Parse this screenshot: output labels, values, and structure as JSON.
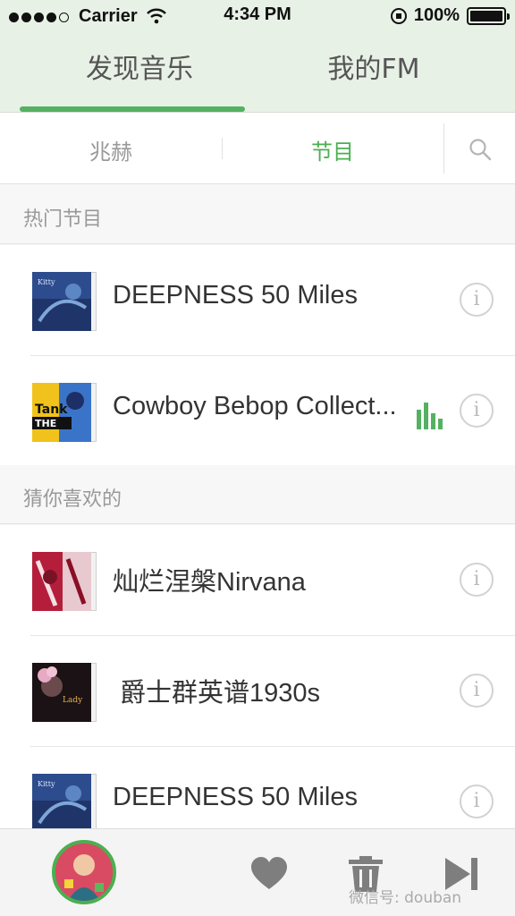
{
  "status_bar": {
    "carrier": "Carrier",
    "time": "4:34 PM",
    "battery": "100%"
  },
  "main_tabs": [
    {
      "label": "发现音乐",
      "active": true
    },
    {
      "label": "我的FM",
      "active": false
    }
  ],
  "segments": [
    {
      "label": "兆赫",
      "active": false
    },
    {
      "label": "节目",
      "active": true
    }
  ],
  "sections": [
    {
      "title": "热门节目",
      "items": [
        {
          "title": "DEEPNESS 50 Miles",
          "cover": "blue-album-art",
          "playing": false
        },
        {
          "title": "Cowboy Bebop Collect...",
          "cover": "cowboy-bebop-art",
          "playing": true
        }
      ]
    },
    {
      "title": "猜你喜欢的",
      "items": [
        {
          "title": "灿烂涅槃Nirvana",
          "cover": "red-album-art",
          "playing": false
        },
        {
          "title": "爵士群英谱1930s",
          "cover": "jazz-portrait-art",
          "playing": false
        },
        {
          "title": "DEEPNESS 50 Miles",
          "cover": "blue-album-art",
          "playing": false
        }
      ]
    }
  ],
  "player": {
    "watermark": "微信号: douban"
  },
  "colors": {
    "accent": "#55b161",
    "header_bg": "#e8f1e6"
  }
}
